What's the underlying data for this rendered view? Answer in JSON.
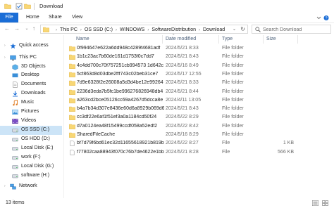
{
  "window": {
    "title": "Download"
  },
  "ribbon": {
    "tabs": [
      "File",
      "Home",
      "Share",
      "View"
    ]
  },
  "address": {
    "crumbs": [
      "This PC",
      "OS SSD (C:)",
      "WINDOWS",
      "SoftwareDistribution",
      "Download"
    ]
  },
  "search": {
    "placeholder": "Search Download"
  },
  "sidebar": {
    "items": [
      {
        "label": "Quick access",
        "icon": "star-icon"
      },
      {
        "label": "This PC",
        "icon": "pc-icon"
      },
      {
        "label": "3D Objects",
        "icon": "cube-icon"
      },
      {
        "label": "Desktop",
        "icon": "desktop-icon"
      },
      {
        "label": "Documents",
        "icon": "documents-icon"
      },
      {
        "label": "Downloads",
        "icon": "download-icon"
      },
      {
        "label": "Music",
        "icon": "music-icon"
      },
      {
        "label": "Pictures",
        "icon": "pictures-icon"
      },
      {
        "label": "Videos",
        "icon": "videos-icon"
      },
      {
        "label": "OS SSD (C:)",
        "icon": "drive-icon",
        "selected": true
      },
      {
        "label": "OS HDD (D:)",
        "icon": "drive-icon"
      },
      {
        "label": "Local Disk (E:)",
        "icon": "drive-icon"
      },
      {
        "label": "work (F:)",
        "icon": "drive-icon"
      },
      {
        "label": "Local Disk (G:)",
        "icon": "drive-icon"
      },
      {
        "label": "software (H:)",
        "icon": "drive-icon"
      },
      {
        "label": "Network",
        "icon": "network-icon"
      }
    ]
  },
  "columns": {
    "name": "Name",
    "date": "Date modified",
    "type": "Type",
    "size": "Size"
  },
  "files": [
    {
      "name": "0f994647e622a6dd948c4289f4681adf",
      "date": "2024/5/21 8:33",
      "type": "File folder",
      "size": ""
    },
    {
      "name": "1b1c23ac7b60de161d1753f0c7dd7",
      "date": "2024/5/21 8:43",
      "type": "File folder",
      "size": ""
    },
    {
      "name": "4c4dd700c70f757251cb994573 1d642c",
      "date": "2024/5/16 8:49",
      "type": "File folder",
      "size": ""
    },
    {
      "name": "5cf863d8d03dbe2fff743c02beb31ce7",
      "date": "2024/5/17 12:55",
      "type": "File folder",
      "size": ""
    },
    {
      "name": "7d9e6328f2e26008a5d3d4be12e99264",
      "date": "2024/5/21 8:33",
      "type": "File folder",
      "size": ""
    },
    {
      "name": "2236d3eda7b5fc1be996276826948db4",
      "date": "2024/5/21 8:44",
      "type": "File folder",
      "size": ""
    },
    {
      "name": "a263cd2bce05126cc69a4267d5dcca8e",
      "date": "2024/4/11 13:05",
      "type": "File folder",
      "size": ""
    },
    {
      "name": "b4a7b34d307e8436e60d6a8929b069d6",
      "date": "2024/5/21 8:43",
      "type": "File folder",
      "size": ""
    },
    {
      "name": "cc3df22e6af1f51ef3a0a1184cd50f24",
      "date": "2024/5/22 8:29",
      "type": "File folder",
      "size": ""
    },
    {
      "name": "d7a0124ea48f15499ccdf058a52edf2",
      "date": "2024/5/22 8:42",
      "type": "File folder",
      "size": ""
    },
    {
      "name": "SharedFileCache",
      "date": "2024/5/16 8:29",
      "type": "File folder",
      "size": ""
    },
    {
      "name": "bf7d79f6bd61ec32d11655618921b819b...",
      "date": "2024/5/22 8:27",
      "type": "File",
      "size": "1 KB"
    },
    {
      "name": "f77802caa88943f070c76b7de4622e1bb9...",
      "date": "2024/5/21 8:28",
      "type": "File",
      "size": "566 KB"
    }
  ],
  "status": {
    "count": "13 items"
  },
  "colors": {
    "accent": "#1a6dd6",
    "folder": "#f8d775",
    "folder_dark": "#e8b84a",
    "selected": "#cce4f7"
  }
}
